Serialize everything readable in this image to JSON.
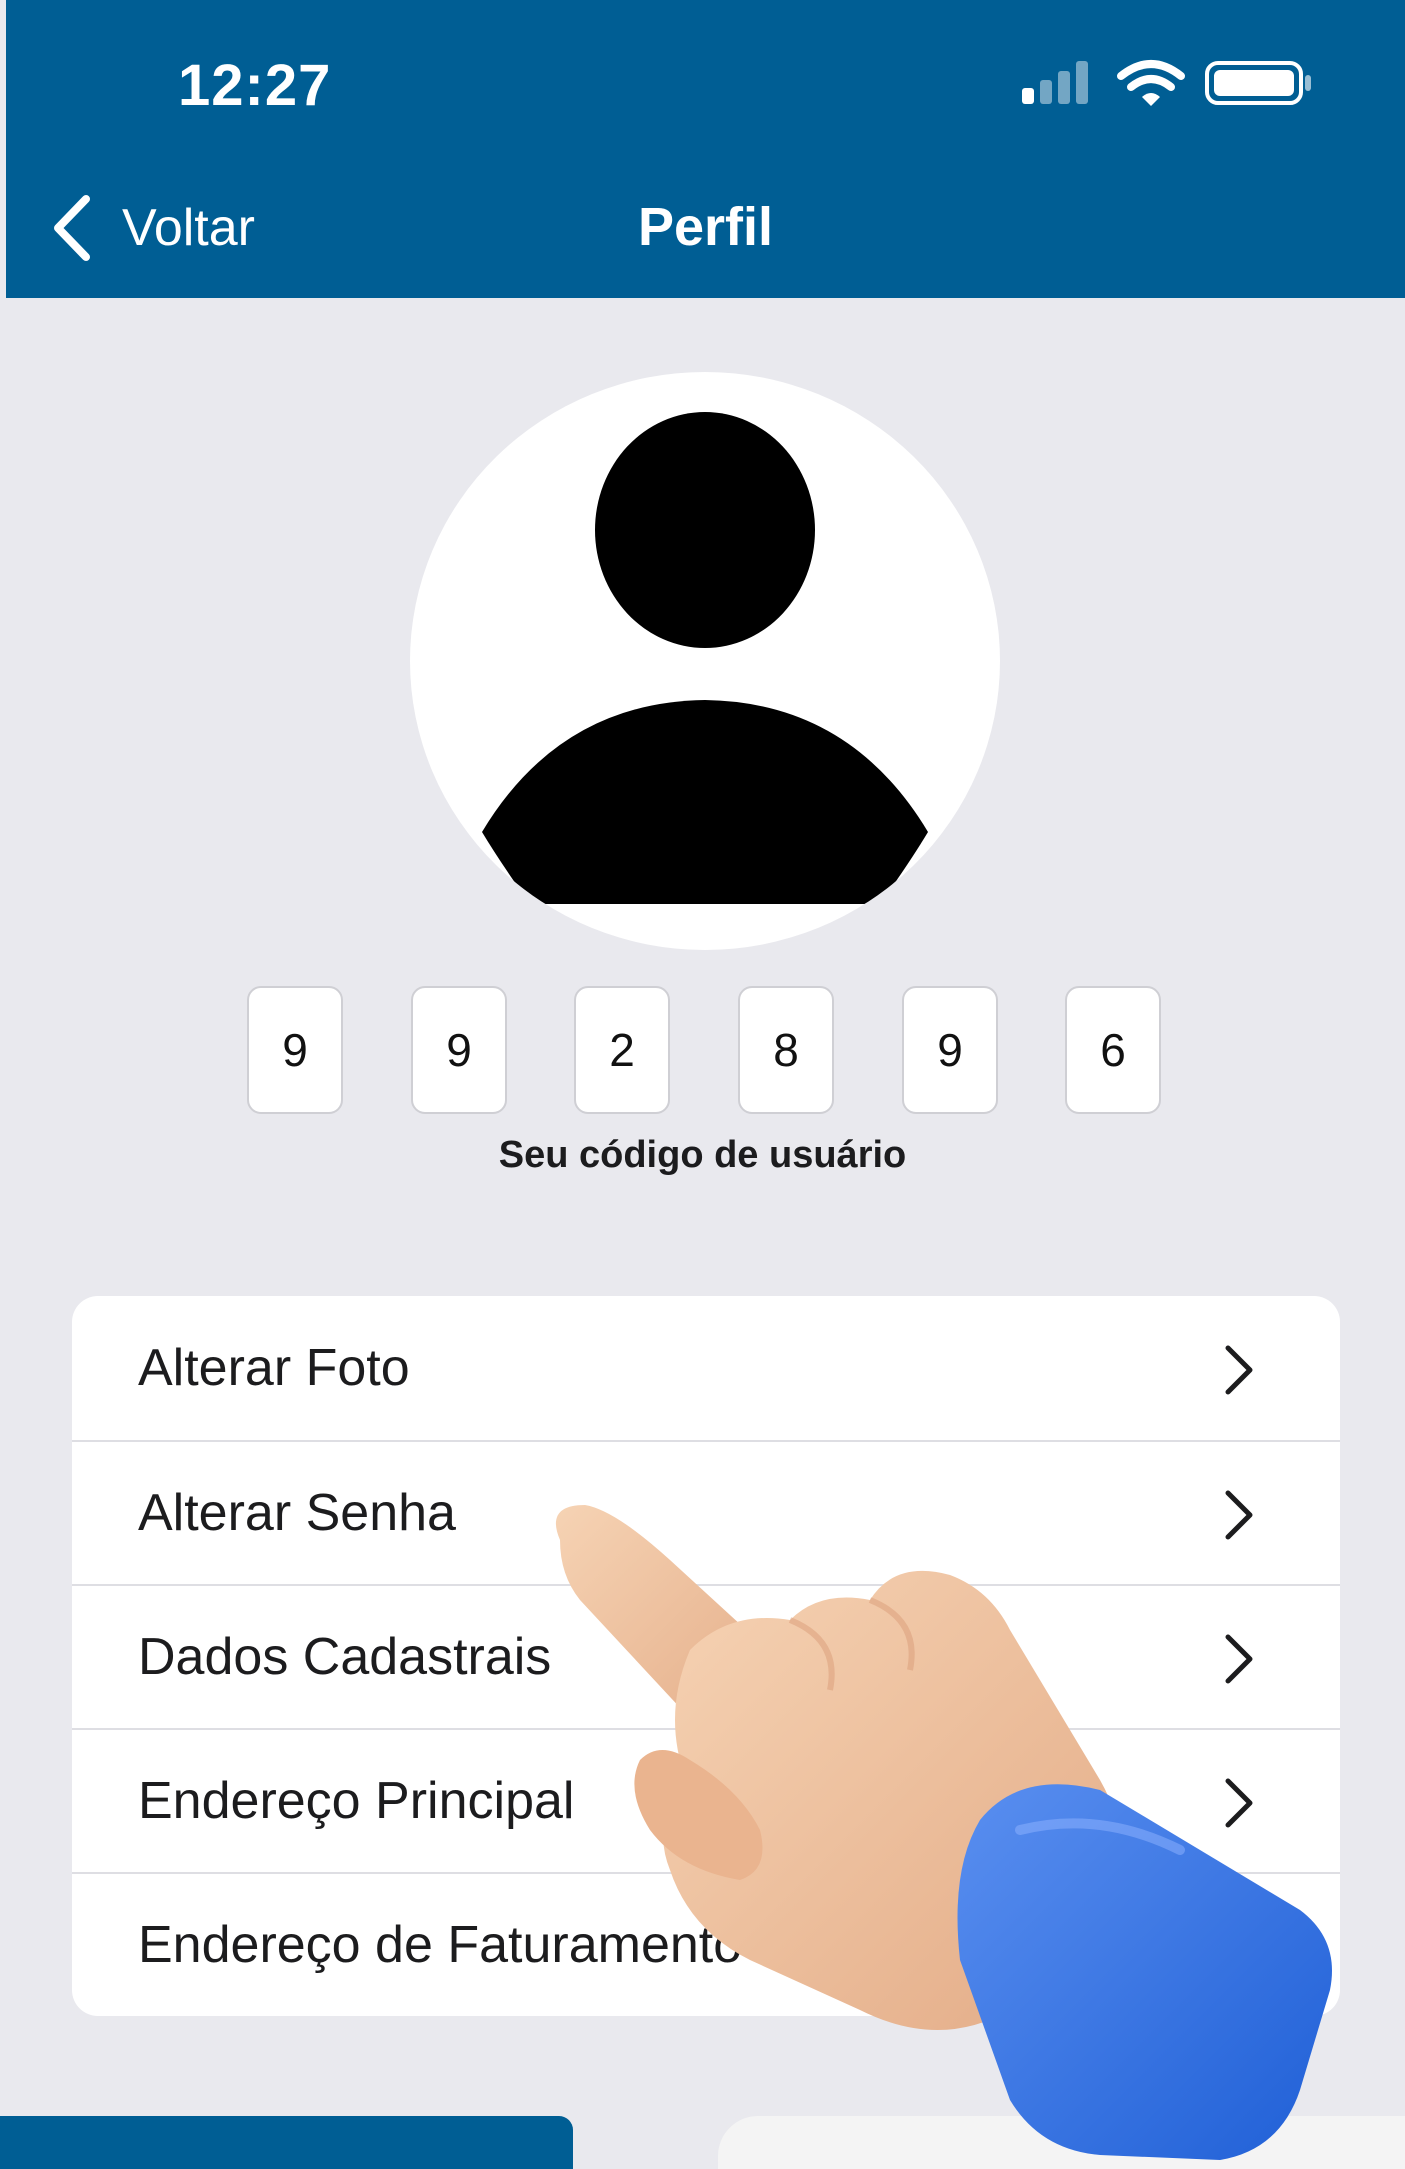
{
  "status_bar": {
    "time": "12:27"
  },
  "nav": {
    "back_label": "Voltar",
    "title": "Perfil"
  },
  "user_code": {
    "digits": [
      "9",
      "9",
      "2",
      "8",
      "9",
      "6"
    ],
    "caption": "Seu código de usuário"
  },
  "menu": {
    "items": [
      {
        "label": "Alterar Foto"
      },
      {
        "label": "Alterar Senha"
      },
      {
        "label": "Dados Cadastrais"
      },
      {
        "label": "Endereço Principal"
      },
      {
        "label": "Endereço de Faturamento"
      }
    ]
  },
  "colors": {
    "header": "#005e94",
    "background": "#e9e9ee",
    "card": "#ffffff",
    "sleeve": "#2f6fe0",
    "skin": "#f1c7a3"
  },
  "icons": {
    "signal": "cellular-signal-icon",
    "wifi": "wifi-icon",
    "battery": "battery-icon",
    "back": "chevron-left-icon",
    "row": "chevron-right-icon",
    "avatar": "person-silhouette-icon"
  }
}
